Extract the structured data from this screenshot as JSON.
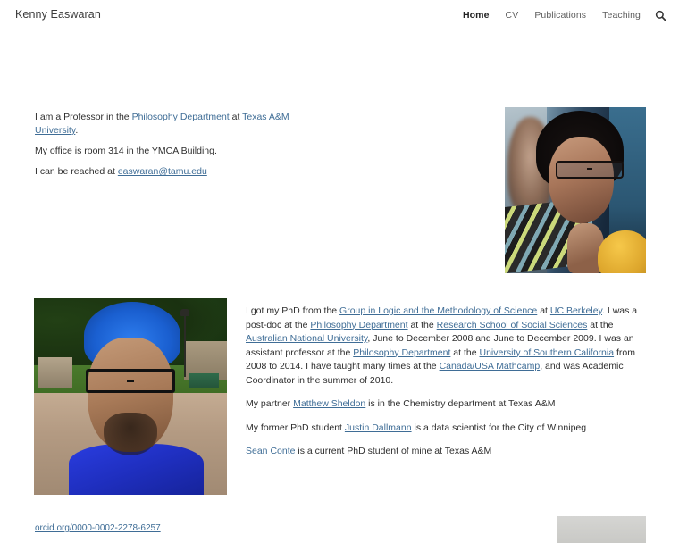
{
  "header": {
    "site_title": "Kenny Easwaran",
    "nav": [
      {
        "label": "Home",
        "active": true
      },
      {
        "label": "CV",
        "active": false
      },
      {
        "label": "Publications",
        "active": false
      },
      {
        "label": "Teaching",
        "active": false
      }
    ],
    "search_icon": "search-icon"
  },
  "intro": {
    "line1": {
      "t1": "I am a Professor in the ",
      "link1": "Philosophy Department",
      "t2": " at ",
      "link2": "Texas A&M University",
      "t3": "."
    },
    "line2": "My office is room 314 in the YMCA Building.",
    "line3": {
      "t1": "I can be reached at ",
      "link1": "easwaran@tamu.edu"
    }
  },
  "bio": {
    "p1": {
      "t1": "I got my PhD from the ",
      "link1": "Group in Logic and the Methodology of Science",
      "t2": " at ",
      "link2": "UC Berkeley",
      "t3": ". I was a post-doc at the ",
      "link3": "Philosophy Department",
      "t4": " at the ",
      "link4": "Research School of Social Sciences",
      "t5": " at the ",
      "link5": "Australian National University",
      "t6": ", June to December 2008 and June to December 2009. I was an assistant professor at the ",
      "link6": "Philosophy Department",
      "t7": " at the ",
      "link7": "University of Southern California",
      "t8": " from 2008 to 2014. I have taught many times at the ",
      "link8": "Canada/USA Mathcamp",
      "t9": ", and was Academic Coordinator in the summer of 2010."
    },
    "p2": {
      "t1": "My partner ",
      "link1": "Matthew Sheldon",
      "t2": " is in the Chemistry department at Texas A&M"
    },
    "p3": {
      "t1": "My former PhD student ",
      "link1": "Justin Dallmann",
      "t2": " is a data scientist for the City of Winnipeg"
    },
    "p4": {
      "link1": "Sean Conte",
      "t1": " is a current PhD student of mine at Texas A&M"
    }
  },
  "footer": {
    "orcid_link": "orcid.org/0000-0002-2278-6257",
    "image_name": "footer-image"
  },
  "images": {
    "top_right_alt": "portrait-photo-seated-man-with-glasses",
    "left_alt": "selfie-photo-man-with-blue-hair-outdoors"
  },
  "colors": {
    "link": "#3f6d96",
    "text": "#2e2e2e",
    "nav": "#5f5f5f",
    "background": "#ffffff"
  }
}
